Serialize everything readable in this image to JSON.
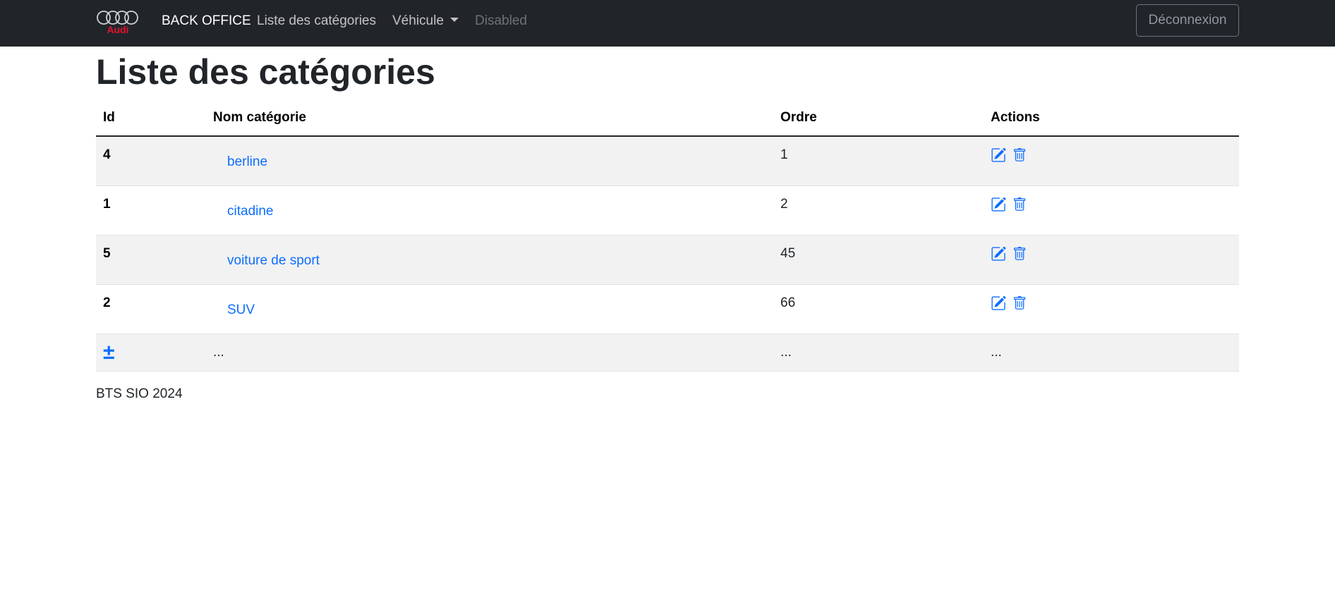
{
  "navbar": {
    "logo_text": "Audi",
    "brand": "BACK OFFICE",
    "links": [
      "Liste des catégories",
      "Véhicule",
      "Disabled"
    ],
    "logout": "Déconnexion"
  },
  "page_title": "Liste des catégories",
  "table": {
    "headers": [
      "Id",
      "Nom catégorie",
      "Ordre",
      "Actions"
    ],
    "rows": [
      {
        "id": "4",
        "name": "berline",
        "ordre": "1"
      },
      {
        "id": "1",
        "name": "citadine",
        "ordre": "2"
      },
      {
        "id": "5",
        "name": "voiture de sport",
        "ordre": "45"
      },
      {
        "id": "2",
        "name": "SUV",
        "ordre": "66"
      }
    ],
    "add_row": {
      "plus": "±",
      "name": "...",
      "ordre": "...",
      "actions": "..."
    }
  },
  "footer": "BTS SIO 2024",
  "colors": {
    "navbar": "#212529",
    "link": "#0d6efd",
    "logo_red": "#e4122f",
    "stripe": "#f2f2f2"
  },
  "icons": {
    "edit": "edit-icon",
    "delete": "trash-icon",
    "add": "plus-minus-icon"
  }
}
